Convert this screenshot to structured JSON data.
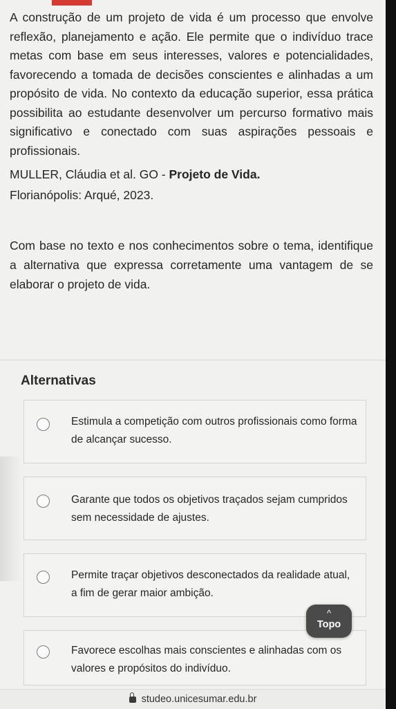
{
  "passage": {
    "text": "A construção de um projeto de vida é um processo que envolve reflexão, planejamento e ação. Ele permite que o indivíduo trace metas com base em seus interesses, valores e potencialidades, favorecendo a tomada de decisões conscientes e alinhadas a um propósito de vida. No contexto da educação superior, essa prática possibilita ao estudante desenvolver um percurso formativo mais significativo e conectado com suas aspirações pessoais e profissionais."
  },
  "citation": {
    "authors": "MULLER, Cláudia et al. GO - ",
    "title": "Projeto de Vida.",
    "publisher": "Florianópolis: Arqué, 2023."
  },
  "question": {
    "text": "Com base no texto e nos conhecimentos sobre o tema, identifique a alternativa que expressa corretamente uma vantagem de se elaborar o projeto de vida."
  },
  "alternatives": {
    "heading": "Alternativas",
    "options": [
      {
        "text": "Estimula a competição com outros profissionais como forma de alcançar sucesso."
      },
      {
        "text": "Garante que todos os objetivos traçados sejam cumpridos sem necessidade de ajustes."
      },
      {
        "text": "Permite traçar objetivos desconectados da realidade atual, a fim de gerar maior ambição."
      },
      {
        "text": "Favorece escolhas mais conscientes e alinhadas com os valores e propósitos do indivíduo."
      }
    ]
  },
  "topo_button": {
    "chevron": "^",
    "label": "Topo"
  },
  "browser": {
    "url": "studeo.unicesumar.edu.br",
    "lock_icon": "lock-icon"
  },
  "colors": {
    "accent_tab": "#d43a2f",
    "background": "#f1f1ef",
    "topo_button": "#4a4a4a"
  }
}
